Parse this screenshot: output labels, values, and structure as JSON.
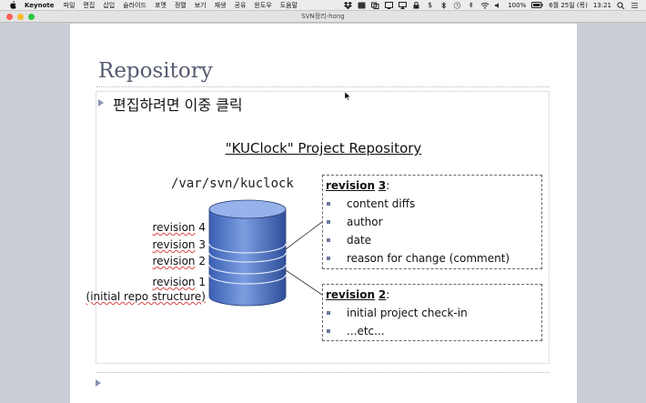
{
  "menubar": {
    "app_name": "Keynote",
    "items": [
      "파일",
      "편집",
      "삽입",
      "슬라이드",
      "포맷",
      "정렬",
      "보기",
      "재생",
      "공유",
      "윈도우",
      "도움말"
    ],
    "battery": "100%",
    "date": "6월 25일 (목)",
    "time": "13:21"
  },
  "window": {
    "title": "SVN정리-hong",
    "traffic_colors": [
      "#fc5f57",
      "#fdbb2d",
      "#28c840"
    ]
  },
  "slide": {
    "title": "Repository",
    "edit_hint": "편집하려면 이중 클릭",
    "diagram": {
      "title": "\"KUClock\" Project Repository",
      "repo_path": "/var/svn/kuclock",
      "revisions": [
        {
          "word": "revision",
          "num": "4"
        },
        {
          "word": "revision",
          "num": "3"
        },
        {
          "word": "revision",
          "num": "2"
        },
        {
          "word": "revision",
          "num": "1"
        }
      ],
      "initial_note": "(initial repo structure)",
      "box1": {
        "word": "revision",
        "num": "3",
        "colon": ":",
        "items": [
          "content diffs",
          "author",
          "date",
          "reason for change (comment)"
        ]
      },
      "box2": {
        "word": "revision",
        "num": "2",
        "colon": ":",
        "items": [
          "initial project check-in",
          "...etc..."
        ]
      }
    }
  }
}
